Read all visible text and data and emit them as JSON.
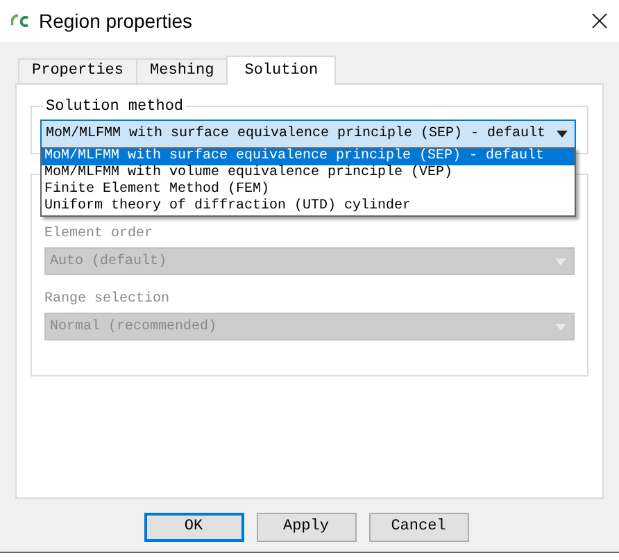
{
  "window": {
    "title": "Region properties"
  },
  "tabs": [
    {
      "label": "Properties",
      "selected": false
    },
    {
      "label": "Meshing",
      "selected": false
    },
    {
      "label": "Solution",
      "selected": true
    }
  ],
  "solution_method": {
    "label": "Solution method",
    "value": "MoM/MLFMM with surface equivalence principle (SEP) - default",
    "expanded": true,
    "options": [
      {
        "label": "MoM/MLFMM with surface equivalence principle (SEP) - default",
        "selected": true
      },
      {
        "label": "MoM/MLFMM with volume equivalence principle (VEP)",
        "selected": false
      },
      {
        "label": "Finite Element Method (FEM)",
        "selected": false
      },
      {
        "label": "Uniform theory of diffraction (UTD) cylinder",
        "selected": false
      }
    ]
  },
  "settings": [
    {
      "label": "Element order",
      "value": "Auto (default)",
      "disabled": true
    },
    {
      "label": "Range selection",
      "value": "Normal (recommended)",
      "disabled": true
    }
  ],
  "buttons": [
    {
      "label": "OK",
      "default": true
    },
    {
      "label": "Apply",
      "default": false
    },
    {
      "label": "Cancel",
      "default": false
    }
  ]
}
